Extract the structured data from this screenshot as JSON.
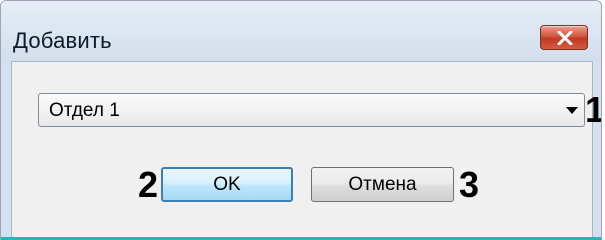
{
  "dialog": {
    "title": "Добавить",
    "close_icon": "close-icon",
    "close_button_color": "#c7432a"
  },
  "department_select": {
    "selected_value": "Отдел 1",
    "arrow_icon": "chevron-down-icon"
  },
  "buttons": {
    "ok_label": "OK",
    "cancel_label": "Отмена"
  },
  "markers": {
    "select": "1",
    "ok": "2",
    "cancel": "3"
  }
}
